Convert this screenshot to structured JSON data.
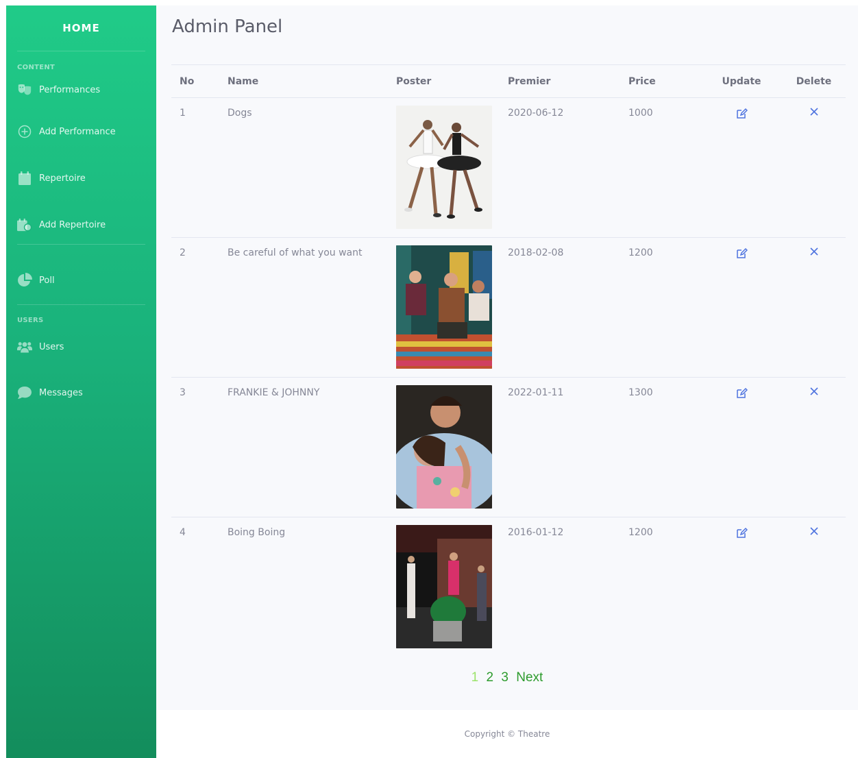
{
  "sidebar": {
    "brand": "HOME",
    "content_heading": "CONTENT",
    "users_heading": "USERS",
    "items": [
      {
        "label": "Performances",
        "icon": "theater-masks-icon"
      },
      {
        "label": "Add Performance",
        "icon": "plus-circle-icon"
      },
      {
        "label": "Repertoire",
        "icon": "calendar-icon"
      },
      {
        "label": "Add Repertoire",
        "icon": "calendar-plus-icon"
      },
      {
        "label": "Poll",
        "icon": "pie-chart-icon"
      },
      {
        "label": "Users",
        "icon": "users-icon"
      },
      {
        "label": "Messages",
        "icon": "comment-icon"
      }
    ]
  },
  "main": {
    "title": "Admin Panel",
    "table": {
      "headers": [
        "No",
        "Name",
        "Poster",
        "Premier",
        "Price",
        "Update",
        "Delete"
      ],
      "rows": [
        {
          "no": "1",
          "name": "Dogs",
          "premier": "2020-06-12",
          "price": "1000"
        },
        {
          "no": "2",
          "name": "Be careful of what you want",
          "premier": "2018-02-08",
          "price": "1200"
        },
        {
          "no": "3",
          "name": "FRANKIE & JOHNNY",
          "premier": "2022-01-11",
          "price": "1300"
        },
        {
          "no": "4",
          "name": "Boing Boing",
          "premier": "2016-01-12",
          "price": "1200"
        }
      ]
    },
    "pagination": {
      "pages": [
        "1",
        "2",
        "3"
      ],
      "active": "1",
      "next": "Next"
    }
  },
  "footer": {
    "copyright": "Copyright © Theatre"
  },
  "colors": {
    "sidebar_top": "#20cb88",
    "sidebar_bottom": "#138d5c",
    "action_icon": "#4e73df",
    "page_active": "#9be36a",
    "page_link": "#2d9b2d"
  }
}
